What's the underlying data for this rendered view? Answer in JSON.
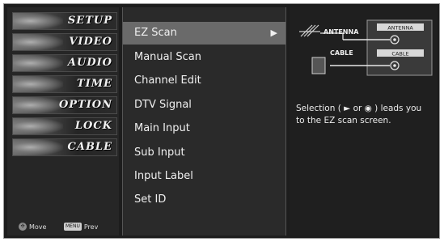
{
  "categories": [
    {
      "label": "SETUP"
    },
    {
      "label": "VIDEO"
    },
    {
      "label": "AUDIO"
    },
    {
      "label": "TIME"
    },
    {
      "label": "OPTION"
    },
    {
      "label": "LOCK"
    },
    {
      "label": "CABLE"
    }
  ],
  "footer": {
    "move_label": "Move",
    "prev_button": "MENU",
    "prev_label": "Prev"
  },
  "menu": {
    "items": [
      {
        "label": "EZ Scan",
        "arrow": "▶"
      },
      {
        "label": "Manual Scan"
      },
      {
        "label": "Channel Edit"
      },
      {
        "label": "DTV Signal"
      },
      {
        "label": "Main Input"
      },
      {
        "label": "Sub Input"
      },
      {
        "label": "Input Label"
      },
      {
        "label": "Set ID"
      }
    ]
  },
  "help": {
    "diagram": {
      "antenna_label": "ANTENNA",
      "cable_label": "CABLE",
      "port_antenna": "ANTENNA",
      "port_cable": "CABLE"
    },
    "text": "Selection ( ► or ◉ ) leads you to the EZ scan screen."
  },
  "colors": {
    "selected_row": "#6a6a6a",
    "panel_bg": "#2a2a2a",
    "text": "#f0f0f0"
  },
  "icons": {
    "move": "move-pad-icon",
    "selected_arrow": "play-arrow-icon"
  }
}
